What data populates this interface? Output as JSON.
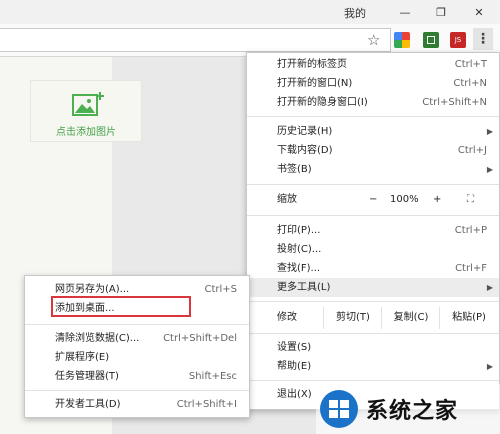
{
  "window": {
    "user_label": "我的",
    "controls": [
      "—",
      "❐",
      "✕"
    ]
  },
  "toolbar": {
    "star_icon": "star-icon",
    "menu_icon": "more-vert-icon"
  },
  "page": {
    "card_label": "点击添加图片"
  },
  "main_menu": {
    "items": [
      {
        "label": "打开新的标签页",
        "shortcut": "Ctrl+T"
      },
      {
        "label": "打开新的窗口(N)",
        "shortcut": "Ctrl+N"
      },
      {
        "label": "打开新的隐身窗口(I)",
        "shortcut": "Ctrl+Shift+N"
      },
      {
        "label": "历史记录(H)",
        "shortcut": ""
      },
      {
        "label": "下载内容(D)",
        "shortcut": "Ctrl+J"
      },
      {
        "label": "书签(B)",
        "shortcut": ""
      },
      {
        "label": "打印(P)...",
        "shortcut": "Ctrl+P"
      },
      {
        "label": "投射(C)...",
        "shortcut": ""
      },
      {
        "label": "查找(F)...",
        "shortcut": "Ctrl+F"
      },
      {
        "label": "更多工具(L)",
        "shortcut": ""
      },
      {
        "label": "设置(S)",
        "shortcut": ""
      },
      {
        "label": "帮助(E)",
        "shortcut": ""
      },
      {
        "label": "退出(X)",
        "shortcut": ""
      }
    ],
    "zoom": {
      "label": "缩放",
      "minus": "−",
      "value": "100%",
      "plus": "+",
      "fullscreen": "⛶"
    },
    "edit": {
      "label": "修改",
      "cut": "剪切(T)",
      "copy": "复制(C)",
      "paste": "粘贴(P)"
    }
  },
  "sub_menu": {
    "items": [
      {
        "label": "网页另存为(A)...",
        "shortcut": "Ctrl+S"
      },
      {
        "label": "添加到桌面...",
        "shortcut": ""
      },
      {
        "label": "清除浏览数据(C)...",
        "shortcut": "Ctrl+Shift+Del"
      },
      {
        "label": "扩展程序(E)",
        "shortcut": ""
      },
      {
        "label": "任务管理器(T)",
        "shortcut": "Shift+Esc"
      },
      {
        "label": "开发者工具(D)",
        "shortcut": "Ctrl+Shift+I"
      }
    ]
  },
  "watermark": {
    "text": "系统之家"
  },
  "colors": {
    "highlight_box": "#d9363e",
    "card_icon": "#4caf50",
    "watermark_blue": "#1a73c8"
  }
}
